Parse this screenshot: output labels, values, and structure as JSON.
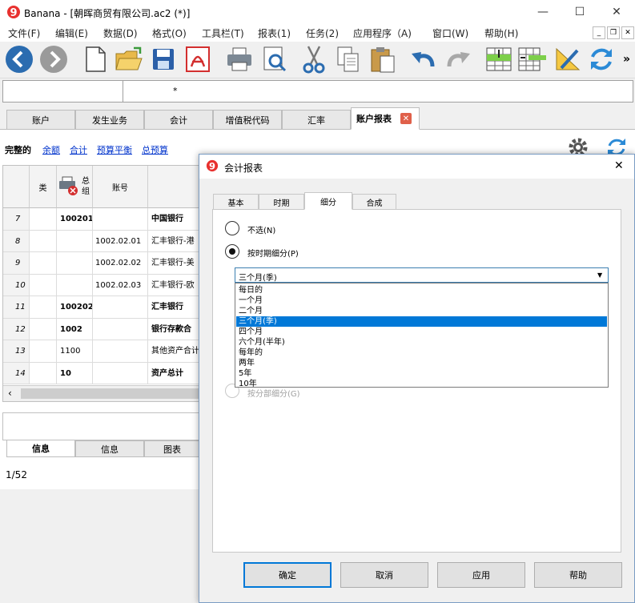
{
  "window": {
    "title": "Banana - [朝晖商贸有限公司.ac2 (*)]",
    "minimize": "—",
    "maximize": "☐",
    "close": "✕"
  },
  "menu": [
    "文件(F)",
    "编辑(E)",
    "数据(D)",
    "格式(O)",
    "工具栏(T)",
    "报表(1)",
    "任务(2)",
    "应用程序（A)",
    "窗口(W)",
    "帮助(H)"
  ],
  "mdi": {
    "minimize": "_",
    "restore": "❐",
    "close": "✕"
  },
  "toolbar": {
    "more": "»"
  },
  "address": {
    "cell_ref": "",
    "cell_content": "*"
  },
  "tabs": [
    "账户",
    "发生业务",
    "会计",
    "增值税代码",
    "汇率",
    "账户报表"
  ],
  "views": [
    "完整的",
    "余额",
    "合计",
    "预算平衡",
    "总预算"
  ],
  "grid": {
    "headers": {
      "type": "类",
      "group": "总组",
      "account": "账号"
    },
    "rows": [
      {
        "n": "7",
        "group": "100201",
        "account": "",
        "desc": "中国银行",
        "bold": true
      },
      {
        "n": "8",
        "group": "",
        "account": "1002.02.01",
        "desc": "汇丰银行-港",
        "bold": false
      },
      {
        "n": "9",
        "group": "",
        "account": "1002.02.02",
        "desc": "汇丰银行-美",
        "bold": false
      },
      {
        "n": "10",
        "group": "",
        "account": "1002.02.03",
        "desc": "汇丰银行-欧",
        "bold": false
      },
      {
        "n": "11",
        "group": "100202",
        "account": "",
        "desc": "汇丰银行",
        "bold": true
      },
      {
        "n": "12",
        "group": "1002",
        "account": "",
        "desc": "银行存款合",
        "bold": true
      },
      {
        "n": "13",
        "group": "1100",
        "account": "",
        "desc": "其他资产合计",
        "bold": false
      },
      {
        "n": "14",
        "group": "10",
        "account": "",
        "desc": "资产总计",
        "bold": true
      }
    ]
  },
  "bottom": {
    "tabs": [
      "信息",
      "信息",
      "图表"
    ],
    "status": "1/52"
  },
  "dialog": {
    "title": "会计报表",
    "close": "✕",
    "tabs": [
      "基本",
      "时期",
      "细分",
      "合成"
    ],
    "radio_none": "不选(N)",
    "radio_period": "按时期细分(P)",
    "radio_segment": "按分部细分(G)",
    "combo_value": "三个月(季)",
    "options": [
      "每日的",
      "一个月",
      "二个月",
      "三个月(季)",
      "四个月",
      "六个月(半年)",
      "每年的",
      "两年",
      "5年",
      "10年"
    ],
    "selected_index": 3,
    "buttons": {
      "ok": "确定",
      "cancel": "取消",
      "apply": "应用",
      "help": "帮助"
    }
  },
  "colors": {
    "accent": "#0078d7",
    "link": "#0033cc",
    "nav_blue": "#2b6cb0",
    "pdf_red": "#d32f2f"
  }
}
